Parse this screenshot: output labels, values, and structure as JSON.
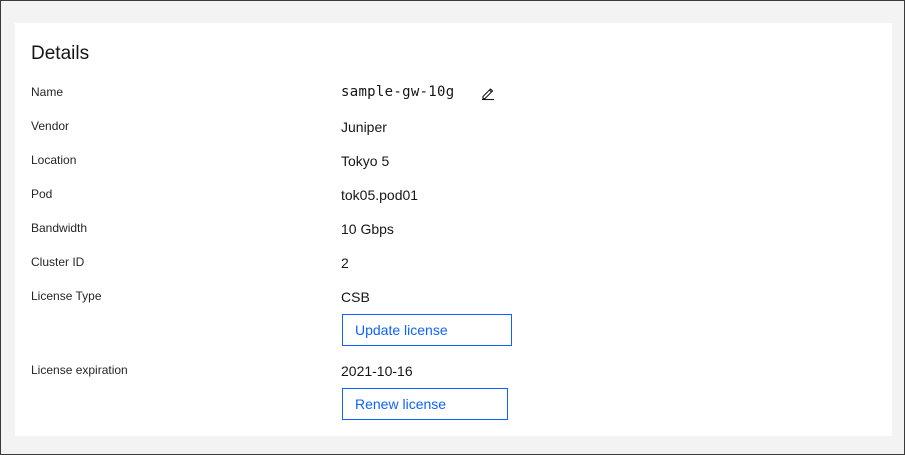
{
  "details": {
    "title": "Details",
    "rows": [
      {
        "label": "Name",
        "value": "sample-gw-10g"
      },
      {
        "label": "Vendor",
        "value": "Juniper"
      },
      {
        "label": "Location",
        "value": "Tokyo 5"
      },
      {
        "label": "Pod",
        "value": "tok05.pod01"
      },
      {
        "label": "Bandwidth",
        "value": "10 Gbps"
      },
      {
        "label": "Cluster ID",
        "value": "2"
      },
      {
        "label": "License Type",
        "value": "CSB"
      },
      {
        "label": "License expiration",
        "value": "2021-10-16"
      }
    ],
    "update_license_label": "Update license",
    "renew_license_label": "Renew license",
    "edit_icon": "edit-pencil-icon",
    "accent_color": "#0f62fe"
  }
}
